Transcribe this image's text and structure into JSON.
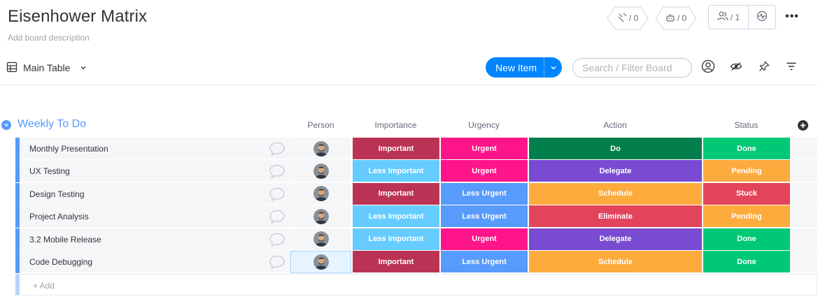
{
  "board": {
    "title": "Eisenhower Matrix",
    "description": "Add board description"
  },
  "top_right": {
    "integrations_count": "/ 0",
    "automations_count": "/ 0",
    "members_count": "/ 1",
    "more_label": "•••"
  },
  "toolbar": {
    "view_label": "Main Table",
    "new_item_label": "New Item",
    "search_placeholder": "Search / Filter Board"
  },
  "group": {
    "title": "Weekly To Do",
    "color": "#579bfc",
    "columns": [
      "Person",
      "Importance",
      "Urgency",
      "Action",
      "Status"
    ],
    "add_item_label": "+ Add",
    "rows": [
      {
        "name": "Monthly Presentation",
        "importance": "Important",
        "urgency": "Urgent",
        "action": "Do",
        "status": "Done"
      },
      {
        "name": "UX Testing",
        "importance": "Less Important",
        "urgency": "Urgent",
        "action": "Delegate",
        "status": "Pending"
      },
      {
        "name": "Design Testing",
        "importance": "Important",
        "urgency": "Less Urgent",
        "action": "Schedule",
        "status": "Stuck"
      },
      {
        "name": "Project Analysis",
        "importance": "Less Important",
        "urgency": "Less Urgent",
        "action": "Eliminate",
        "status": "Pending"
      },
      {
        "name": "3.2 Mobile Release",
        "importance": "Less Important",
        "urgency": "Urgent",
        "action": "Delegate",
        "status": "Done"
      },
      {
        "name": "Code Debugging",
        "importance": "Important",
        "urgency": "Less Urgent",
        "action": "Schedule",
        "status": "Done"
      }
    ]
  },
  "label_colors": {
    "Important": "#bb3354",
    "Less Important": "#66ccff",
    "Urgent": "#ff158a",
    "Less Urgent": "#579bfc",
    "Do": "#037f4c",
    "Delegate": "#784bd1",
    "Schedule": "#fdab3d",
    "Eliminate": "#e2445c",
    "Done": "#00c875",
    "Pending": "#fdab3d",
    "Stuck": "#e2445c"
  },
  "icons": {
    "integrations": "integrations-icon",
    "automations": "robot-icon",
    "members": "person-icon",
    "activity": "activity-icon",
    "table": "table-icon",
    "person_filter": "person-circle-icon",
    "hide": "eye-slash-icon",
    "pin": "pin-icon",
    "sort": "sort-icon",
    "chat": "chat-bubble-icon",
    "group_toggle": "chevron-down-icon",
    "add_column": "plus-circle-icon"
  }
}
